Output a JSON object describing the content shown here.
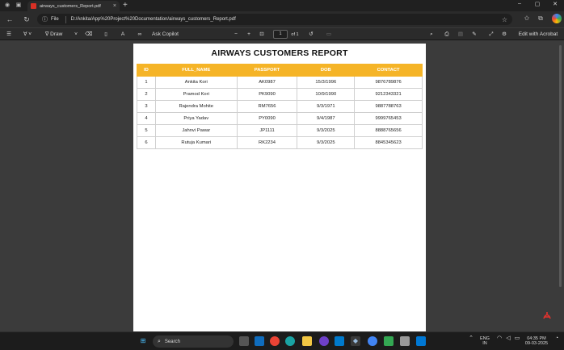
{
  "browser": {
    "tab_title": "airways_customers_Report.pdf",
    "tab_close": "×",
    "new_tab": "+",
    "address_scheme": "File",
    "address_path": "D:/Ankita/App%20Project%20Documentation/airways_customers_Report.pdf",
    "window_controls": [
      "–",
      "▢",
      "✕"
    ]
  },
  "pdf_toolbar": {
    "draw_label": "Draw",
    "ask_copilot_label": "Ask Copilot",
    "zoom_out": "−",
    "zoom_in": "+",
    "current_page": "1",
    "page_total": "of 1",
    "edit_with_acrobat": "Edit with Acrobat"
  },
  "report": {
    "title": "AIRWAYS CUSTOMERS REPORT",
    "columns": [
      "ID",
      "FULL_NAME",
      "PASSPORT",
      "DOB",
      "CONTACT"
    ],
    "rows": [
      [
        "1",
        "Ankita Kori",
        "AK0987",
        "15/3/1996",
        "9876789876"
      ],
      [
        "2",
        "Pramod Kori",
        "PK9090",
        "10/9/1990",
        "9212343321"
      ],
      [
        "3",
        "Rajendra Mohite",
        "RM7656",
        "9/3/1971",
        "9887788763"
      ],
      [
        "4",
        "Priya Yadav",
        "PY0090",
        "9/4/1987",
        "9999765453"
      ],
      [
        "5",
        "Jahnvi Pawar",
        "JP1111",
        "9/3/2025",
        "8888765656"
      ],
      [
        "6",
        "Rutuja Kumari",
        "RK2234",
        "9/3/2025",
        "8845345623"
      ]
    ],
    "header_color": "#f5b427"
  },
  "taskbar": {
    "search_placeholder": "Search",
    "language": "ENG",
    "region": "IN",
    "time": "04:35 PM",
    "date": "09-03-2025"
  }
}
